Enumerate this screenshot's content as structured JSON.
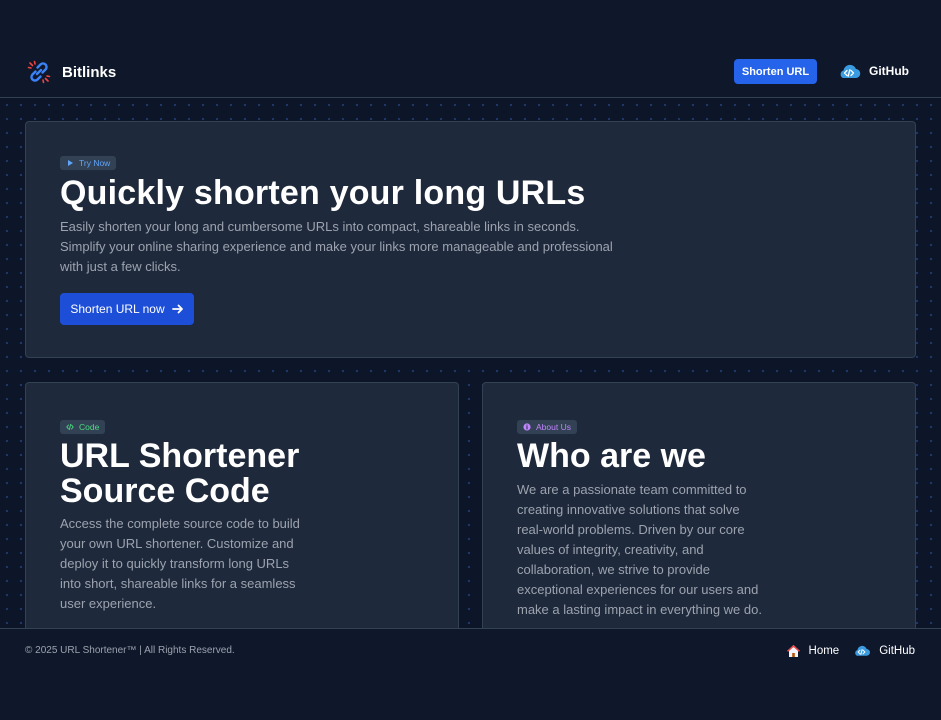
{
  "header": {
    "brand": "Bitlinks",
    "brand_icon": "link-icon",
    "nav_button": "Shorten URL",
    "github_label": "GitHub",
    "github_icon": "github-cloud-icon"
  },
  "hero": {
    "tag": "Try Now",
    "title": "Quickly shorten your long URLs",
    "description": "Easily shorten your long and cumbersome URLs into compact, shareable links in seconds. Simplify your online sharing experience and make your links more manageable and professional with just a few clicks.",
    "cta_label": "Shorten URL now"
  },
  "source_card": {
    "tag": "Code",
    "title": "URL Shortener Source Code",
    "description": "Access the complete source code to build your own URL shortener. Customize and deploy it to quickly transform long URLs into short, shareable links for a seamless user experience."
  },
  "about_card": {
    "tag": "About Us",
    "title": "Who are we",
    "description": "We are a passionate team committed to creating innovative solutions that solve real-world problems. Driven by our core values of integrity, creativity, and collaboration, we strive to provide exceptional experiences for our users and make a lasting impact in everything we do."
  },
  "footer": {
    "copyright": "© 2025 URL Shortener™ | All Rights Reserved.",
    "home_label": "Home",
    "github_label": "GitHub"
  },
  "colors": {
    "background": "#0f172a",
    "card": "#1e293b",
    "accent": "#2563eb",
    "muted_text": "#9ca3af"
  }
}
